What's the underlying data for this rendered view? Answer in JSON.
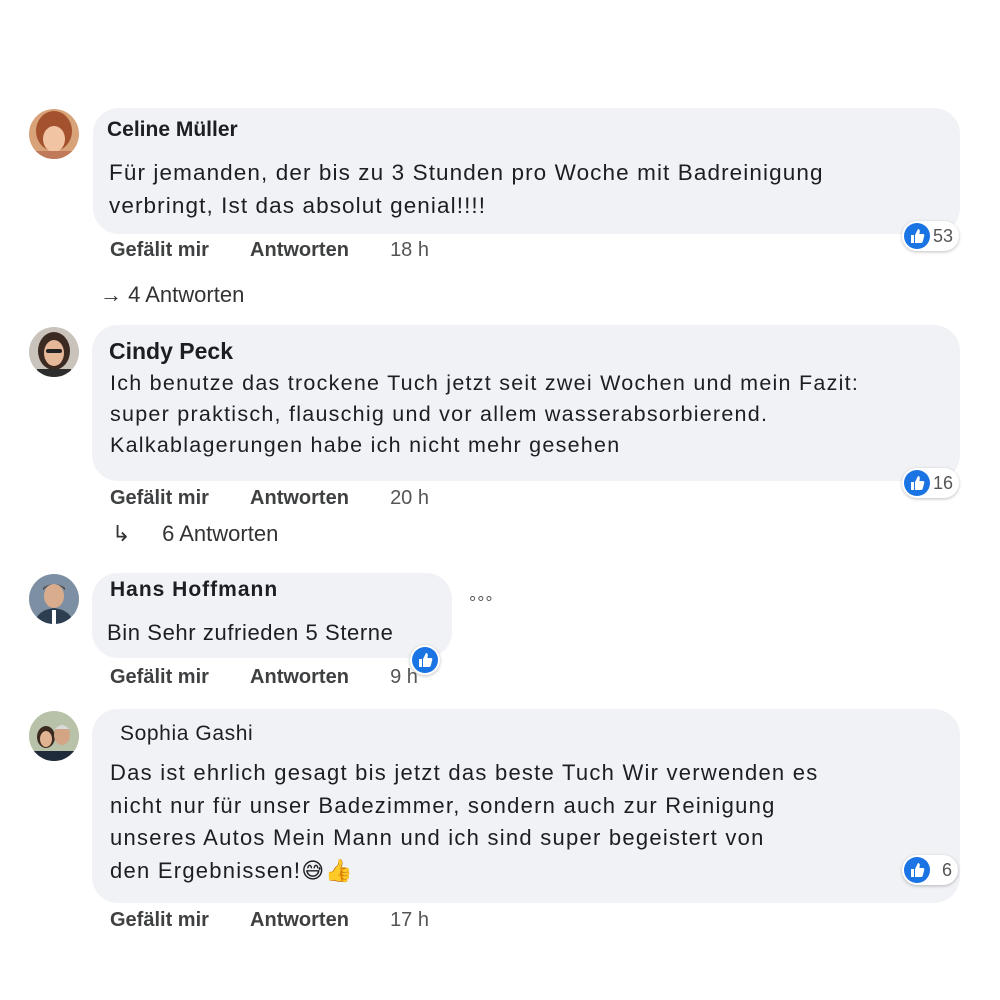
{
  "comments": [
    {
      "author": "Celine Müller",
      "text": "Für jemanden, der bis zu 3 Stunden pro Woche mit Badreinigung\nverbringt, Ist das absolut genial!!!!",
      "like_label": "Gefälit mir",
      "reply_label": "Antworten",
      "time": "18 h",
      "reaction_count": "53",
      "replies_label": "4 Antworten",
      "replies_arrow": "→"
    },
    {
      "author": "Cindy Peck",
      "text": "Ich benutze das trockene Tuch jetzt seit zwei Wochen und mein Fazit:\nsuper praktisch, flauschig und vor allem wasserabsorbierend.\nKalkablagerungen habe ich nicht mehr gesehen",
      "like_label": "Gefälit mir",
      "reply_label": "Antworten",
      "time": "20 h",
      "reaction_count": "16",
      "replies_label": "6 Antworten",
      "replies_arrow": "↳"
    },
    {
      "author": "Hans Hoffmann",
      "text": "Bin Sehr zufrieden 5 Sterne",
      "like_label": "Gefälit mir",
      "reply_label": "Antworten",
      "time": "9 h",
      "more_label": "°°°"
    },
    {
      "author": "Sophia Gashi",
      "text": "Das ist ehrlich gesagt bis jetzt das beste Tuch Wir verwenden es\nnicht nur für unser Badezimmer, sondern auch zur Reinigung\nunseres Autos Mein Mann und ich sind super begeistert von\nden Ergebnissen!😅👍",
      "like_label": "Gefälit mir",
      "reply_label": "Antworten",
      "time": "17 h",
      "reaction_count": "6"
    }
  ],
  "colors": {
    "bubble": "#f0f2f5",
    "like_blue": "#1b74e4",
    "text": "#1c1e21"
  },
  "icons": {
    "avatar": "avatar-photo",
    "reaction": "like-thumb-icon",
    "more": "more-options-icon",
    "reply_arrow": "reply-arrow-icon"
  }
}
